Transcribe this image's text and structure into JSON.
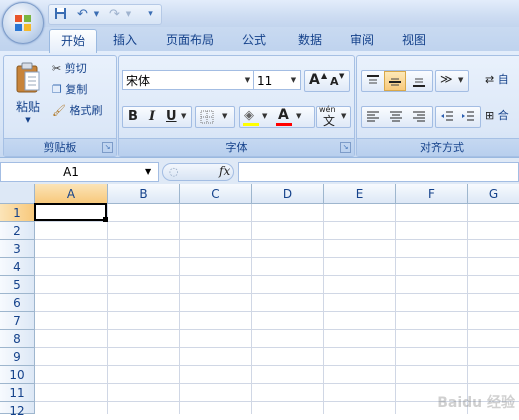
{
  "quick_access": {
    "icons": [
      "save-icon",
      "undo-icon",
      "redo-icon",
      "customize-icon"
    ]
  },
  "tabs": [
    {
      "label": "开始",
      "active": true
    },
    {
      "label": "插入"
    },
    {
      "label": "页面布局"
    },
    {
      "label": "公式"
    },
    {
      "label": "数据"
    },
    {
      "label": "审阅"
    },
    {
      "label": "视图"
    }
  ],
  "clipboard": {
    "label": "剪贴板",
    "paste": "粘贴",
    "cut": "剪切",
    "copy": "复制",
    "format_painter": "格式刷"
  },
  "font": {
    "label": "字体",
    "font_name": "宋体",
    "font_size": "11",
    "bold": "B",
    "italic": "I",
    "underline": "U",
    "grow": "A",
    "shrink": "A",
    "font_color": "A",
    "phonetic": "wén",
    "highlight_color": "#ffff00",
    "font_color_value": "#ff0000"
  },
  "alignment": {
    "label": "对齐方式",
    "wrap_text_partial": "自",
    "merge_partial": "合"
  },
  "formula_bar": {
    "name_box": "A1",
    "fx": "fx"
  },
  "columns": [
    "A",
    "B",
    "C",
    "D",
    "E",
    "F",
    "G"
  ],
  "rows": [
    "1",
    "2",
    "3",
    "4",
    "5",
    "6",
    "7",
    "8",
    "9",
    "10",
    "11",
    "12"
  ],
  "watermark": "Baidu 经验"
}
